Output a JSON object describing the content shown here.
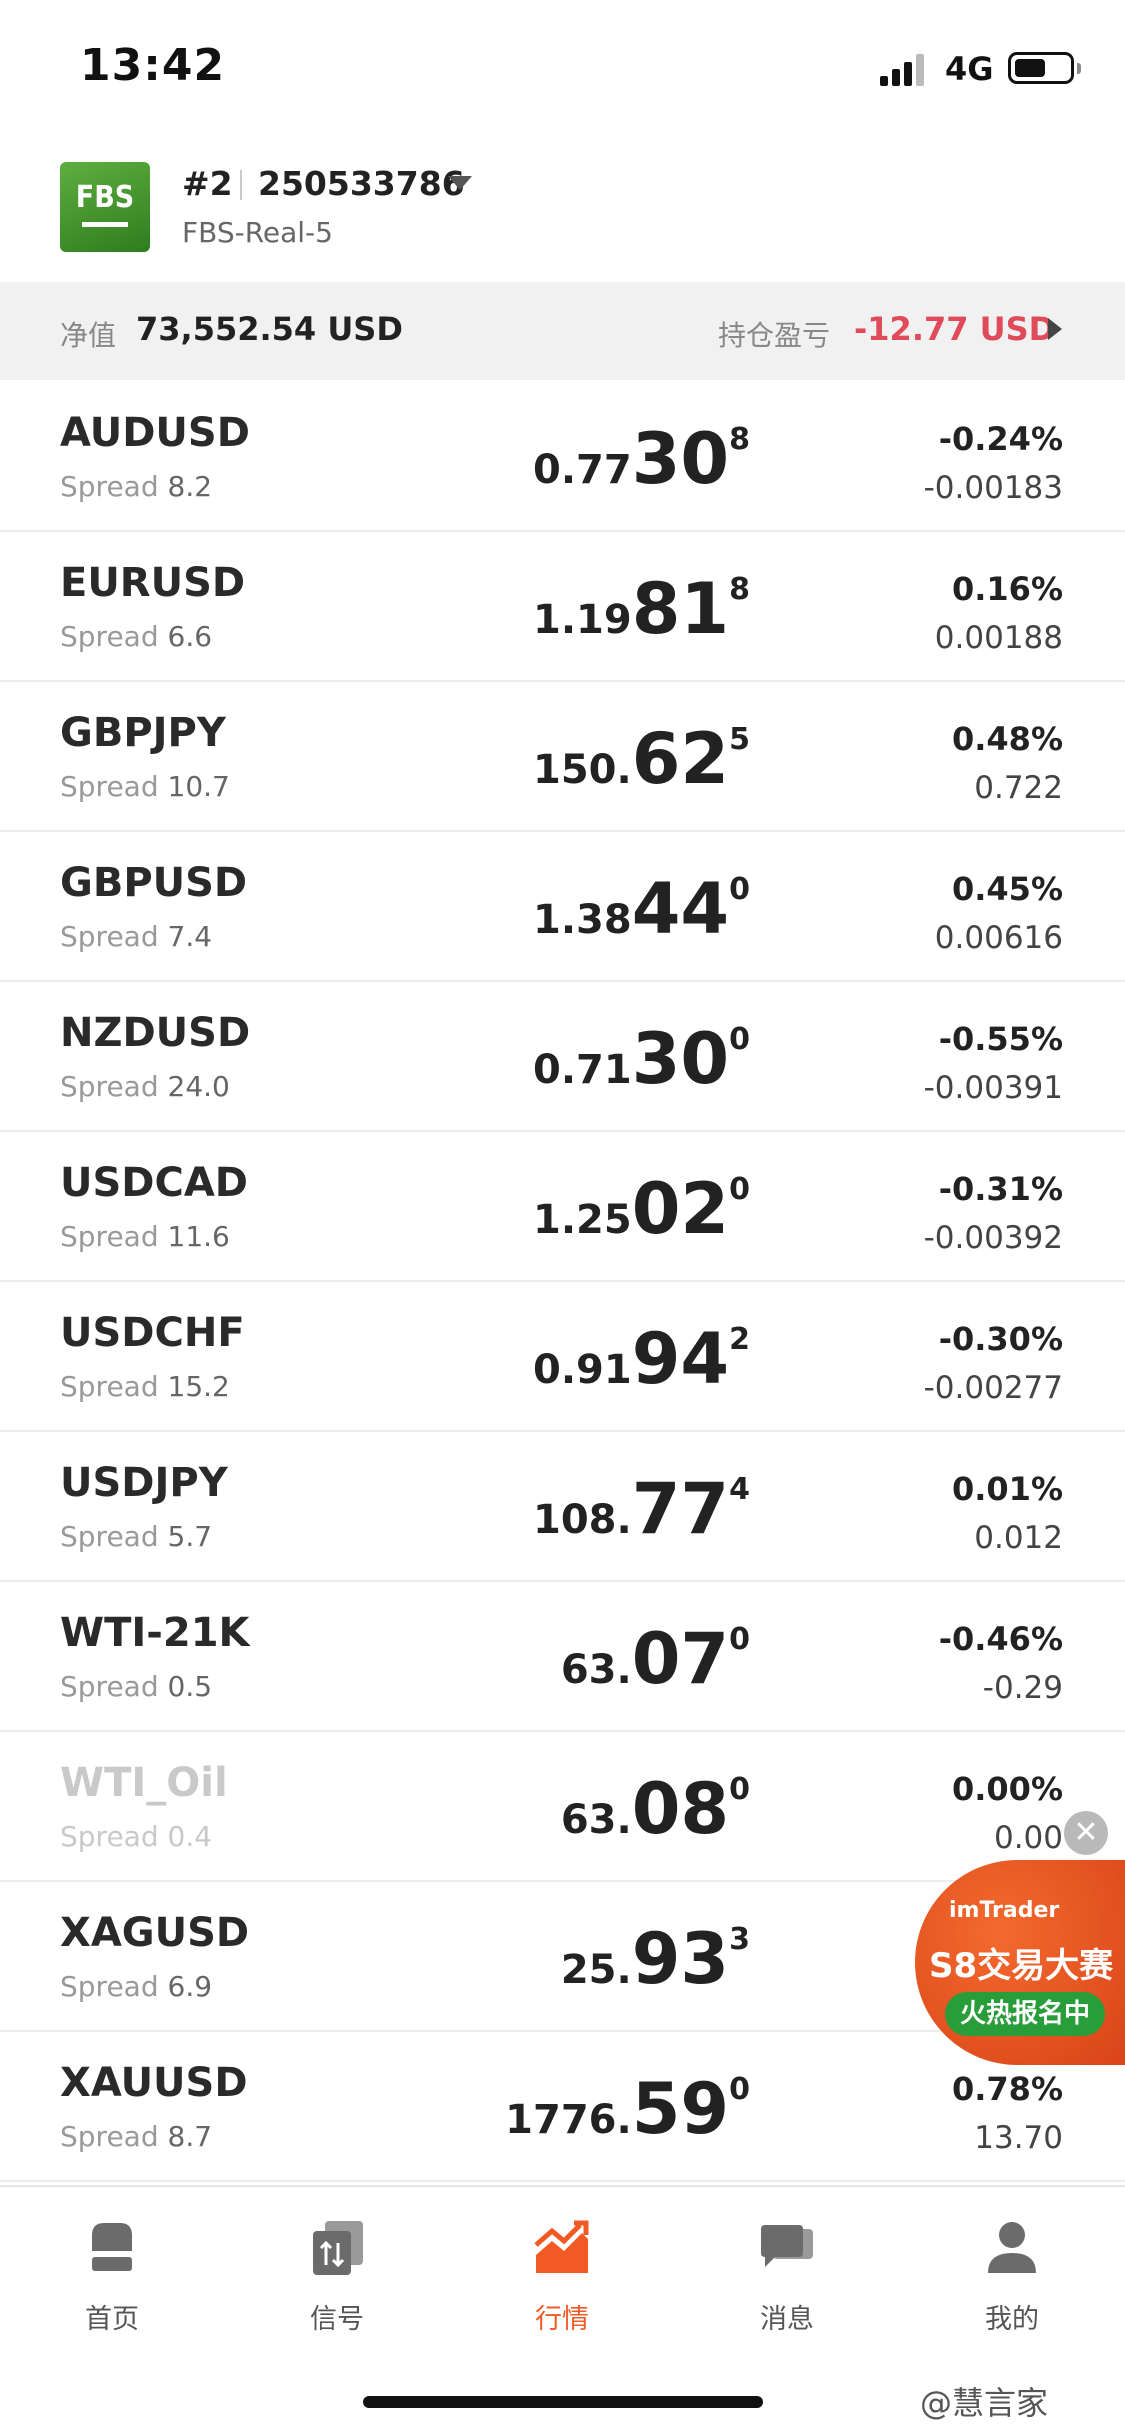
{
  "status_bar": {
    "time": "13:42",
    "network": "4G"
  },
  "account": {
    "logo": "FBS",
    "number": "#2",
    "id": "250533786",
    "server": "FBS-Real-5"
  },
  "equity_bar": {
    "equity_label": "净值",
    "equity_value": "73,552.54 USD",
    "pl_label": "持仓盈亏",
    "pl_value": "-12.77 USD"
  },
  "quotes": [
    {
      "symbol": "AUDUSD",
      "spread_label": "Spread",
      "spread": "8.2",
      "price_small": "0.77",
      "price_big": "30",
      "price_sup": "8",
      "change_pct": "-0.24%",
      "change": "-0.00183"
    },
    {
      "symbol": "EURUSD",
      "spread_label": "Spread",
      "spread": "6.6",
      "price_small": "1.19",
      "price_big": "81",
      "price_sup": "8",
      "change_pct": "0.16%",
      "change": "0.00188"
    },
    {
      "symbol": "GBPJPY",
      "spread_label": "Spread",
      "spread": "10.7",
      "price_small": "150.",
      "price_big": "62",
      "price_sup": "5",
      "change_pct": "0.48%",
      "change": "0.722"
    },
    {
      "symbol": "GBPUSD",
      "spread_label": "Spread",
      "spread": "7.4",
      "price_small": "1.38",
      "price_big": "44",
      "price_sup": "0",
      "change_pct": "0.45%",
      "change": "0.00616"
    },
    {
      "symbol": "NZDUSD",
      "spread_label": "Spread",
      "spread": "24.0",
      "price_small": "0.71",
      "price_big": "30",
      "price_sup": "0",
      "change_pct": "-0.55%",
      "change": "-0.00391"
    },
    {
      "symbol": "USDCAD",
      "spread_label": "Spread",
      "spread": "11.6",
      "price_small": "1.25",
      "price_big": "02",
      "price_sup": "0",
      "change_pct": "-0.31%",
      "change": "-0.00392"
    },
    {
      "symbol": "USDCHF",
      "spread_label": "Spread",
      "spread": "15.2",
      "price_small": "0.91",
      "price_big": "94",
      "price_sup": "2",
      "change_pct": "-0.30%",
      "change": "-0.00277"
    },
    {
      "symbol": "USDJPY",
      "spread_label": "Spread",
      "spread": "5.7",
      "price_small": "108.",
      "price_big": "77",
      "price_sup": "4",
      "change_pct": "0.01%",
      "change": "0.012"
    },
    {
      "symbol": "WTI-21K",
      "spread_label": "Spread",
      "spread": "0.5",
      "price_small": "63.",
      "price_big": "07",
      "price_sup": "0",
      "change_pct": "-0.46%",
      "change": "-0.29"
    },
    {
      "symbol": "WTI_Oil",
      "spread_label": "Spread",
      "spread": "0.4",
      "price_small": "63.",
      "price_big": "08",
      "price_sup": "0",
      "change_pct": "0.00%",
      "change": "0.00"
    },
    {
      "symbol": "XAGUSD",
      "spread_label": "Spread",
      "spread": "6.9",
      "price_small": "25.",
      "price_big": "93",
      "price_sup": "3",
      "change_pct": "",
      "change": ""
    },
    {
      "symbol": "XAUUSD",
      "spread_label": "Spread",
      "spread": "8.7",
      "price_small": "1776.",
      "price_big": "59",
      "price_sup": "0",
      "change_pct": "0.78%",
      "change": "13.70"
    }
  ],
  "ad": {
    "brand": "imTrader",
    "title": "S8交易大赛",
    "button": "火热报名中",
    "close": "✕"
  },
  "tabs": [
    {
      "label": "首页",
      "icon": "home-icon"
    },
    {
      "label": "信号",
      "icon": "signal-icon"
    },
    {
      "label": "行情",
      "icon": "market-chart-icon"
    },
    {
      "label": "消息",
      "icon": "message-icon"
    },
    {
      "label": "我的",
      "icon": "profile-icon"
    }
  ],
  "colors": {
    "accent": "#f15a24",
    "loss": "#e04b5a",
    "brand_green": "#3f8f2a"
  },
  "watermark": "@慧言家"
}
